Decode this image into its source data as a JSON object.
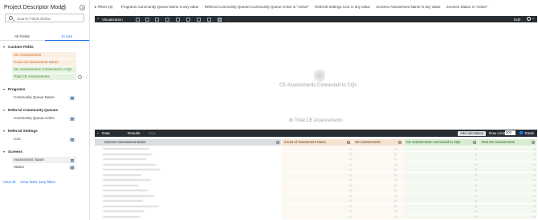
{
  "sidebar": {
    "title": "Project Descriptor Model",
    "search_placeholder": "Search Fields Below",
    "tabs": [
      "All Fields",
      "In Use"
    ],
    "groups": {
      "custom_fields": {
        "label": "Custom Fields",
        "items": [
          "CE Assessments",
          "Count of Assessment Name",
          "CE Assessments Connected to CQs",
          "Total CE Assessments"
        ]
      },
      "programs": {
        "label": "Programs",
        "items": [
          "Community Queue Name"
        ]
      },
      "referral_queues": {
        "label": "Referral Community Queues",
        "items": [
          "Community Queue Active"
        ]
      },
      "referral_settings": {
        "label": "Referral Settings",
        "items": [
          "CoC"
        ]
      },
      "screens": {
        "label": "Screens",
        "items": [
          "Assessment Name",
          "Status"
        ]
      }
    },
    "links": {
      "clear_all": "Clear all",
      "clear_fields": "Clear fields, keep filters"
    }
  },
  "filters": {
    "toggle_label": "Filters (5)",
    "chips": [
      {
        "name": "Programs Community Queue Name",
        "value": "is any value"
      },
      {
        "name": "Referral Community Queues Community Queue Active",
        "value": "is \"Active\""
      },
      {
        "name": "Referral Settings CoC",
        "value": "is any value"
      },
      {
        "name": "Screens Assessment Name",
        "value": "is any value"
      },
      {
        "name": "Screens Status",
        "value": "is \"Active\""
      }
    ]
  },
  "visualization": {
    "label": "Visualization",
    "edit_label": "Edit",
    "single_value_caption": "CE Assessments Connected to CQs",
    "total_caption": "Total CE Assessments",
    "toolbar_icons": [
      "table-icon",
      "column-chart-icon",
      "bar-chart-icon",
      "scatter-icon",
      "line-icon",
      "area-icon",
      "pie-icon",
      "map-icon",
      "single-value-icon",
      "more-icon"
    ]
  },
  "data": {
    "tabs": [
      "Data",
      "Results",
      "SQL"
    ],
    "add_calculation": "Add calculation",
    "row_limit_label": "Row Limit",
    "row_limit_value": "500",
    "totals_label": "Totals",
    "columns": [
      "Screens Assessment Name",
      "Count of Assessment Name",
      "CE Assessments",
      "CE Assessments Connected to CQs",
      "Total CE Assessments"
    ]
  },
  "colors": {
    "dimension_bg": "#fbeee2",
    "dimension_text": "#c26b1f",
    "measure_bg": "#e6f3e2",
    "measure_text": "#4a8a2f",
    "header_dark": "#262d33",
    "accent": "#1a73e8"
  }
}
